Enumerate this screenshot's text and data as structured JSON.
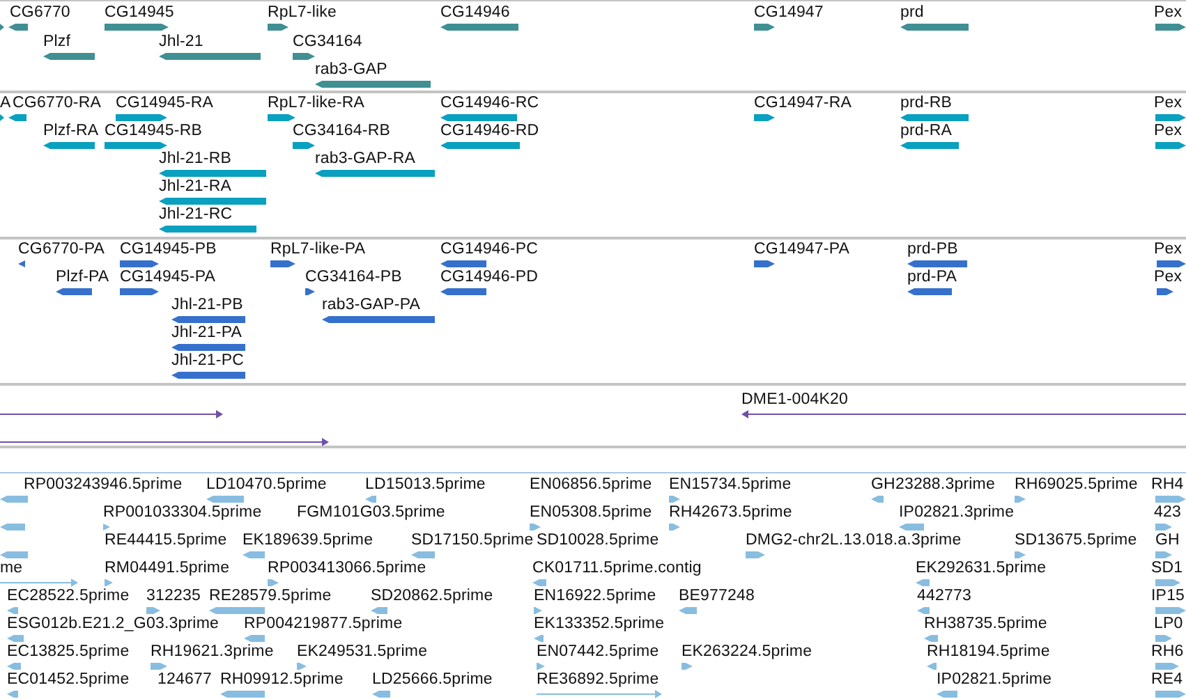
{
  "tracks": [
    {
      "kind": "gene",
      "features": [
        {
          "reverse": false
        },
        {
          "label": "CG6770",
          "reverse": true
        },
        {
          "label": "CG14945",
          "reverse": false
        },
        {
          "label": "RpL7-like",
          "reverse": false
        },
        {
          "label": "CG14946",
          "reverse": true
        },
        {
          "label": "CG14947",
          "reverse": false
        },
        {
          "label": "prd",
          "reverse": true
        },
        {
          "label": "Pex",
          "reverse": false
        },
        {
          "label": "Plzf",
          "reverse": true
        },
        {
          "label": "Jhl-21",
          "reverse": true
        },
        {
          "label": "CG34164",
          "reverse": false
        },
        {
          "label": "rab3-GAP",
          "reverse": true
        }
      ]
    },
    {
      "kind": "transcript",
      "features": [
        {
          "label": "A",
          "reverse": false
        },
        {
          "label": "CG6770-RA",
          "reverse": true
        },
        {
          "label": "CG14945-RA",
          "reverse": false
        },
        {
          "label": "RpL7-like-RA",
          "reverse": false
        },
        {
          "label": "CG14946-RC",
          "reverse": true
        },
        {
          "label": "CG14947-RA",
          "reverse": false
        },
        {
          "label": "prd-RB",
          "reverse": true
        },
        {
          "label": "Pex",
          "reverse": false
        },
        {
          "label": "Plzf-RA",
          "reverse": true
        },
        {
          "label": "CG14945-RB",
          "reverse": false
        },
        {
          "label": "CG34164-RB",
          "reverse": false
        },
        {
          "label": "CG14946-RD",
          "reverse": true
        },
        {
          "label": "prd-RA",
          "reverse": true
        },
        {
          "label": "Pex",
          "reverse": false
        },
        {
          "label": "Jhl-21-RB",
          "reverse": true
        },
        {
          "label": "rab3-GAP-RA",
          "reverse": true
        },
        {
          "label": "Jhl-21-RA",
          "reverse": true
        },
        {
          "label": "Jhl-21-RC",
          "reverse": true
        }
      ]
    },
    {
      "kind": "protein",
      "features": [
        {
          "label": "CG6770-PA",
          "reverse": true
        },
        {
          "label": "CG14945-PB",
          "reverse": false
        },
        {
          "label": "RpL7-like-PA",
          "reverse": false
        },
        {
          "label": "CG14946-PC",
          "reverse": true
        },
        {
          "label": "CG14947-PA",
          "reverse": false
        },
        {
          "label": "prd-PB",
          "reverse": true
        },
        {
          "label": "Pex",
          "reverse": false
        },
        {
          "label": "Plzf-PA",
          "reverse": true
        },
        {
          "label": "CG14945-PA",
          "reverse": false
        },
        {
          "label": "CG34164-PB",
          "reverse": false
        },
        {
          "label": "CG14946-PD",
          "reverse": true
        },
        {
          "label": "prd-PA",
          "reverse": true
        },
        {
          "label": "Pex",
          "reverse": false
        },
        {
          "label": "Jhl-21-PB",
          "reverse": true
        },
        {
          "label": "rab3-GAP-PA",
          "reverse": true
        },
        {
          "label": "Jhl-21-PA",
          "reverse": true
        },
        {
          "label": "Jhl-21-PC",
          "reverse": true
        }
      ]
    },
    {
      "kind": "clone",
      "features": [
        {
          "reverse": false
        },
        {
          "label": "DME1-004K20",
          "reverse": true
        },
        {
          "reverse": false
        }
      ]
    },
    {
      "kind": "est",
      "features": [
        {
          "reverse": true
        },
        {
          "label": "RP003243946.5prime"
        },
        {
          "label": "LD10470.5prime",
          "reverse": true
        },
        {
          "label": "LD15013.5prime",
          "reverse": true
        },
        {
          "label": "EN06856.5prime"
        },
        {
          "label": "EN15734.5prime",
          "reverse": false
        },
        {
          "label": "GH23288.3prime",
          "reverse": true
        },
        {
          "label": "RH69025.5prime",
          "reverse": false
        },
        {
          "label": "RH4",
          "reverse": false
        },
        {
          "reverse": true
        },
        {
          "label": "RP001033304.5prime",
          "reverse": false
        },
        {
          "label": "FGM101G03.5prime"
        },
        {
          "label": "EN05308.5prime",
          "reverse": false
        },
        {
          "label": "RH42673.5prime",
          "reverse": false
        },
        {
          "label": "IP02821.3prime",
          "reverse": true
        },
        {
          "label": "423",
          "reverse": false
        },
        {
          "reverse": true
        },
        {
          "label": "RE44415.5prime"
        },
        {
          "label": "EK189639.5prime",
          "reverse": true
        },
        {
          "label": "SD17150.5prime",
          "reverse": true
        },
        {
          "label": "SD10028.5prime"
        },
        {
          "label": "DMG2-chr2L.13.018.a.3prime",
          "reverse": false
        },
        {
          "label": "SD13675.5prime",
          "reverse": false
        },
        {
          "label": "GH",
          "reverse": false
        },
        {
          "label": "me",
          "reverse": false
        },
        {
          "label": "RM04491.5prime",
          "reverse": false
        },
        {
          "label": "RP003413066.5prime",
          "reverse": false
        },
        {
          "label": "CK01711.5prime.contig",
          "reverse": true
        },
        {
          "label": "EK292631.5prime",
          "reverse": true
        },
        {
          "label": "SD1",
          "reverse": false
        },
        {
          "label": "EC28522.5prime",
          "reverse": true
        },
        {
          "label": "312235",
          "reverse": false
        },
        {
          "label": "RE28579.5prime",
          "reverse": true
        },
        {
          "label": "SD20862.5prime",
          "reverse": true
        },
        {
          "label": "EN16922.5prime",
          "reverse": false
        },
        {
          "label": "BE977248",
          "reverse": true
        },
        {
          "label": "442773",
          "reverse": true
        },
        {
          "label": "IP15",
          "reverse": false
        },
        {
          "label": "ESG012b.E21.2_G03.3prime",
          "reverse": true
        },
        {
          "label": "RP004219877.5prime",
          "reverse": true
        },
        {
          "label": "EK133352.5prime",
          "reverse": true
        },
        {
          "label": "RH38735.5prime",
          "reverse": true
        },
        {
          "label": "LP0",
          "reverse": false
        },
        {
          "label": "EC13825.5prime",
          "reverse": true
        },
        {
          "label": "RH19621.3prime",
          "reverse": false
        },
        {
          "label": "EK249531.5prime",
          "reverse": false
        },
        {
          "label": "EN07442.5prime",
          "reverse": false
        },
        {
          "label": "EK263224.5prime",
          "reverse": false
        },
        {
          "label": "RH18194.5prime",
          "reverse": true
        },
        {
          "label": "RH6",
          "reverse": false
        },
        {
          "label": "EC01452.5prime",
          "reverse": true
        },
        {
          "label": "124677"
        },
        {
          "label": "RH09912.5prime",
          "reverse": true
        },
        {
          "label": "LD25666.5prime",
          "reverse": true
        },
        {
          "label": "RE36892.5prime",
          "reverse": false
        },
        {
          "label": "IP02821.5prime",
          "reverse": true
        },
        {
          "label": "RE4",
          "reverse": false
        }
      ]
    }
  ]
}
